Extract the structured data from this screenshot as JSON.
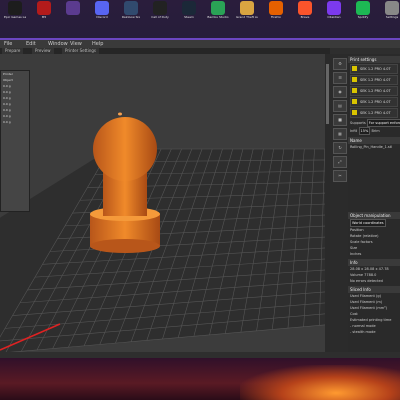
{
  "desktop": {
    "icons": [
      {
        "label": "Epic Games Launcher",
        "name": "epic-icon",
        "color": "#1d1d1d"
      },
      {
        "label": "M5",
        "name": "m5-icon",
        "color": "#b31b1b"
      },
      {
        "label": "",
        "name": "app-icon",
        "color": "#5b3b8f"
      },
      {
        "label": "Discord",
        "name": "discord-icon",
        "color": "#5865f2"
      },
      {
        "label": "Rainbow Six",
        "name": "r6-icon",
        "color": "#314a6e"
      },
      {
        "label": "Call of Duty",
        "name": "cod-icon",
        "color": "#222"
      },
      {
        "label": "Steam",
        "name": "steam-icon",
        "color": "#1b2838"
      },
      {
        "label": "Bambu Studio",
        "name": "bambu-icon",
        "color": "#2aa356"
      },
      {
        "label": "Grand Theft Auto",
        "name": "gta-icon",
        "color": "#d9a441"
      },
      {
        "label": "Firefox",
        "name": "firefox-icon",
        "color": "#e66000"
      },
      {
        "label": "Brave",
        "name": "brave-icon",
        "color": "#fb542b"
      },
      {
        "label": "Obsidian",
        "name": "obsidian-icon",
        "color": "#7c3aed"
      },
      {
        "label": "Spotify",
        "name": "spotify-icon",
        "color": "#1db954"
      },
      {
        "label": "Settings",
        "name": "settings-icon",
        "color": "#888"
      }
    ]
  },
  "app": {
    "menu": [
      "File",
      "Edit",
      "Window",
      "View",
      "Help"
    ],
    "tabs": [
      "Prepare",
      "Preview",
      "Printer Settings"
    ],
    "left_panel_lines": [
      "Printer",
      "",
      "",
      "Object",
      "  0.0 g",
      "  0.0 g",
      "  0.0 g",
      "  0.0 g",
      "  0.0 g",
      "  0.0 g",
      "  0.0 g"
    ],
    "right_panel": {
      "print_settings": "Print settings",
      "plates": [
        "SEK 1.2 PRO 4.0T",
        "SEK 1.2 PRO 4.0T",
        "SEK 1.2 PRO 4.0T",
        "SEK 1.2 PRO 4.0T",
        "SEK 1.2 PRO 4.0T"
      ],
      "supports_label": "Supports",
      "supports_value": "For support enforcers",
      "infill_label": "Infill",
      "infill_value": "15%",
      "brim_label": "Brim",
      "name_label": "Name",
      "object_name": "Rolling_Pin_Handle_1.stl",
      "object_manipulation": "Object manipulation",
      "coord": "World coordinates",
      "position": "Position",
      "rotate": "Rotate (relative)",
      "scale_factors": "Scale factors",
      "size": "Size",
      "inches": "Inches",
      "info": "Info",
      "size_value": "28.08 x 28.08 x 47.78",
      "volume": "Volume",
      "volume_value": "7788.0",
      "errors": "No errors detected",
      "sliced_info": "Sliced Info",
      "used_filament": "Used Filament (g)",
      "used_filament_m": "Used Filament (m)",
      "used_filament_mm3": "Used Filament (mm³)",
      "cost": "Cost",
      "est_time": "Estimated printing time",
      "normal_mode": "- normal mode",
      "stealth_mode": "- stealth mode"
    }
  },
  "model": {
    "color": "#e07a1f",
    "bed_grid": "#5a5a5a"
  },
  "icons": {
    "arrow": "arrow-icon",
    "gear": "gear-icon"
  }
}
